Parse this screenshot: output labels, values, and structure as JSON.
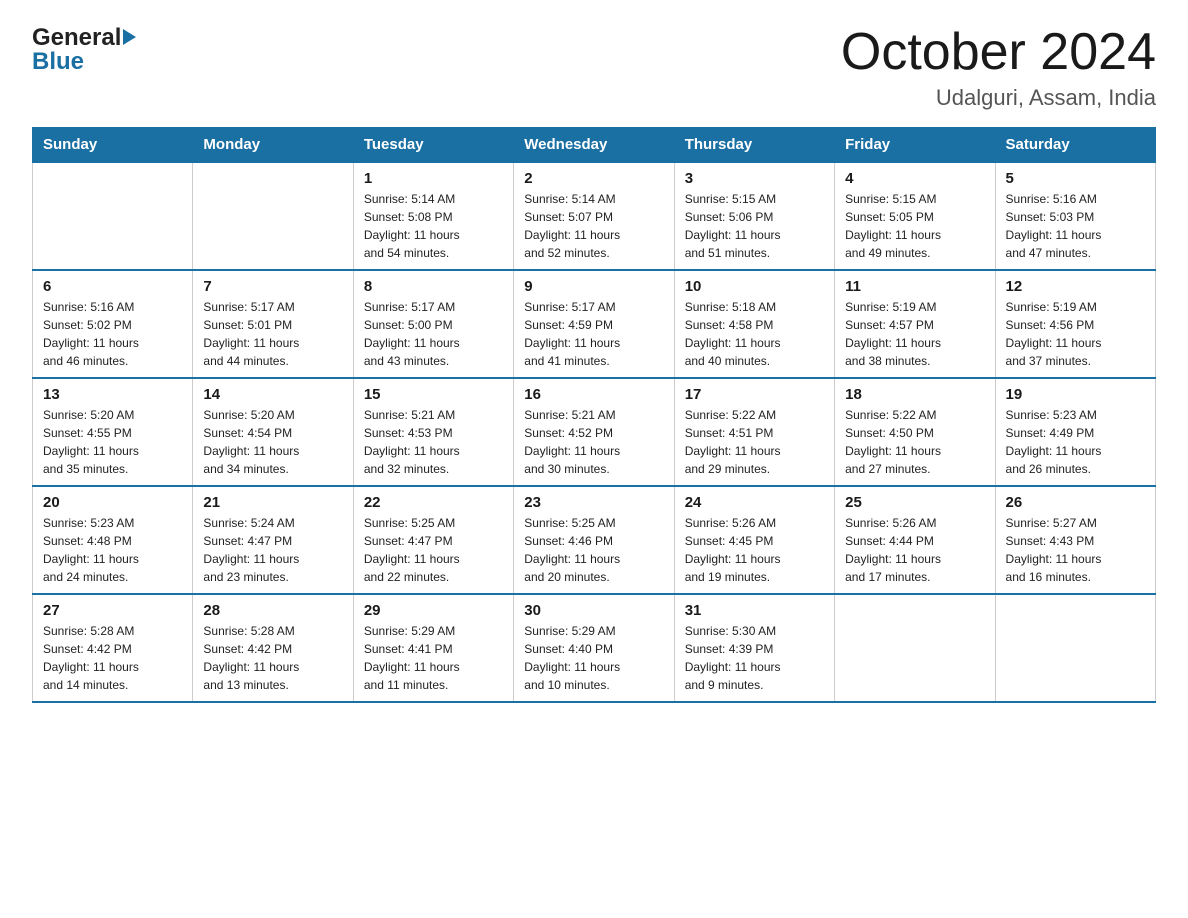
{
  "header": {
    "month_title": "October 2024",
    "location": "Udalguri, Assam, India",
    "logo_general": "General",
    "logo_blue": "Blue"
  },
  "days_of_week": [
    "Sunday",
    "Monday",
    "Tuesday",
    "Wednesday",
    "Thursday",
    "Friday",
    "Saturday"
  ],
  "weeks": [
    [
      {
        "day": "",
        "info": ""
      },
      {
        "day": "",
        "info": ""
      },
      {
        "day": "1",
        "info": "Sunrise: 5:14 AM\nSunset: 5:08 PM\nDaylight: 11 hours\nand 54 minutes."
      },
      {
        "day": "2",
        "info": "Sunrise: 5:14 AM\nSunset: 5:07 PM\nDaylight: 11 hours\nand 52 minutes."
      },
      {
        "day": "3",
        "info": "Sunrise: 5:15 AM\nSunset: 5:06 PM\nDaylight: 11 hours\nand 51 minutes."
      },
      {
        "day": "4",
        "info": "Sunrise: 5:15 AM\nSunset: 5:05 PM\nDaylight: 11 hours\nand 49 minutes."
      },
      {
        "day": "5",
        "info": "Sunrise: 5:16 AM\nSunset: 5:03 PM\nDaylight: 11 hours\nand 47 minutes."
      }
    ],
    [
      {
        "day": "6",
        "info": "Sunrise: 5:16 AM\nSunset: 5:02 PM\nDaylight: 11 hours\nand 46 minutes."
      },
      {
        "day": "7",
        "info": "Sunrise: 5:17 AM\nSunset: 5:01 PM\nDaylight: 11 hours\nand 44 minutes."
      },
      {
        "day": "8",
        "info": "Sunrise: 5:17 AM\nSunset: 5:00 PM\nDaylight: 11 hours\nand 43 minutes."
      },
      {
        "day": "9",
        "info": "Sunrise: 5:17 AM\nSunset: 4:59 PM\nDaylight: 11 hours\nand 41 minutes."
      },
      {
        "day": "10",
        "info": "Sunrise: 5:18 AM\nSunset: 4:58 PM\nDaylight: 11 hours\nand 40 minutes."
      },
      {
        "day": "11",
        "info": "Sunrise: 5:19 AM\nSunset: 4:57 PM\nDaylight: 11 hours\nand 38 minutes."
      },
      {
        "day": "12",
        "info": "Sunrise: 5:19 AM\nSunset: 4:56 PM\nDaylight: 11 hours\nand 37 minutes."
      }
    ],
    [
      {
        "day": "13",
        "info": "Sunrise: 5:20 AM\nSunset: 4:55 PM\nDaylight: 11 hours\nand 35 minutes."
      },
      {
        "day": "14",
        "info": "Sunrise: 5:20 AM\nSunset: 4:54 PM\nDaylight: 11 hours\nand 34 minutes."
      },
      {
        "day": "15",
        "info": "Sunrise: 5:21 AM\nSunset: 4:53 PM\nDaylight: 11 hours\nand 32 minutes."
      },
      {
        "day": "16",
        "info": "Sunrise: 5:21 AM\nSunset: 4:52 PM\nDaylight: 11 hours\nand 30 minutes."
      },
      {
        "day": "17",
        "info": "Sunrise: 5:22 AM\nSunset: 4:51 PM\nDaylight: 11 hours\nand 29 minutes."
      },
      {
        "day": "18",
        "info": "Sunrise: 5:22 AM\nSunset: 4:50 PM\nDaylight: 11 hours\nand 27 minutes."
      },
      {
        "day": "19",
        "info": "Sunrise: 5:23 AM\nSunset: 4:49 PM\nDaylight: 11 hours\nand 26 minutes."
      }
    ],
    [
      {
        "day": "20",
        "info": "Sunrise: 5:23 AM\nSunset: 4:48 PM\nDaylight: 11 hours\nand 24 minutes."
      },
      {
        "day": "21",
        "info": "Sunrise: 5:24 AM\nSunset: 4:47 PM\nDaylight: 11 hours\nand 23 minutes."
      },
      {
        "day": "22",
        "info": "Sunrise: 5:25 AM\nSunset: 4:47 PM\nDaylight: 11 hours\nand 22 minutes."
      },
      {
        "day": "23",
        "info": "Sunrise: 5:25 AM\nSunset: 4:46 PM\nDaylight: 11 hours\nand 20 minutes."
      },
      {
        "day": "24",
        "info": "Sunrise: 5:26 AM\nSunset: 4:45 PM\nDaylight: 11 hours\nand 19 minutes."
      },
      {
        "day": "25",
        "info": "Sunrise: 5:26 AM\nSunset: 4:44 PM\nDaylight: 11 hours\nand 17 minutes."
      },
      {
        "day": "26",
        "info": "Sunrise: 5:27 AM\nSunset: 4:43 PM\nDaylight: 11 hours\nand 16 minutes."
      }
    ],
    [
      {
        "day": "27",
        "info": "Sunrise: 5:28 AM\nSunset: 4:42 PM\nDaylight: 11 hours\nand 14 minutes."
      },
      {
        "day": "28",
        "info": "Sunrise: 5:28 AM\nSunset: 4:42 PM\nDaylight: 11 hours\nand 13 minutes."
      },
      {
        "day": "29",
        "info": "Sunrise: 5:29 AM\nSunset: 4:41 PM\nDaylight: 11 hours\nand 11 minutes."
      },
      {
        "day": "30",
        "info": "Sunrise: 5:29 AM\nSunset: 4:40 PM\nDaylight: 11 hours\nand 10 minutes."
      },
      {
        "day": "31",
        "info": "Sunrise: 5:30 AM\nSunset: 4:39 PM\nDaylight: 11 hours\nand 9 minutes."
      },
      {
        "day": "",
        "info": ""
      },
      {
        "day": "",
        "info": ""
      }
    ]
  ]
}
